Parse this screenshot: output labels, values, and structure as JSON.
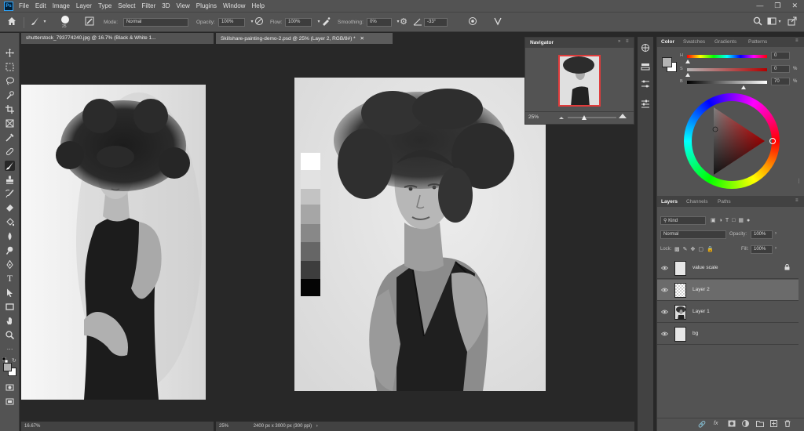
{
  "menu": {
    "logo": "Ps",
    "items": [
      "File",
      "Edit",
      "Image",
      "Layer",
      "Type",
      "Select",
      "Filter",
      "3D",
      "View",
      "Plugins",
      "Window",
      "Help"
    ]
  },
  "options": {
    "brush_size": "25",
    "mode_label": "Mode:",
    "mode_value": "Normal",
    "opacity_label": "Opacity:",
    "opacity_value": "100%",
    "flow_label": "Flow:",
    "flow_value": "100%",
    "smoothing_label": "Smoothing:",
    "smoothing_value": "0%",
    "angle_value": "-33°"
  },
  "documents": {
    "left": {
      "tab": "shutterstock_793774240.jpg @ 16.7% (Black & White 1...",
      "status": "16.67%"
    },
    "main": {
      "tab": "Skillshare-painting-demo-2.psd @ 25% (Layer 2, RGB/8#) *",
      "status_zoom": "25%",
      "status_info": "2400 px x 3000 px (300 ppi)"
    }
  },
  "navigator": {
    "title": "Navigator",
    "zoom": "25%"
  },
  "color_panel": {
    "tabs": [
      "Color",
      "Swatches",
      "Gradients",
      "Patterns"
    ],
    "h_value": "0",
    "s_value": "0",
    "b_value": "70",
    "percent": "%",
    "colors": {
      "foreground": "#b3b3b3",
      "background": "#ffffff",
      "wheel_point": "#ff1a1a"
    }
  },
  "layers_panel": {
    "tabs": [
      "Layers",
      "Channels",
      "Paths"
    ],
    "kind": "Kind",
    "blend_mode": "Normal",
    "opacity_label": "Opacity:",
    "opacity_value": "100%",
    "lock_label": "Lock:",
    "fill_label": "Fill:",
    "fill_value": "100%",
    "layers": [
      {
        "name": "value scale",
        "selected": false,
        "locked": true
      },
      {
        "name": "Layer 2",
        "selected": true,
        "locked": false
      },
      {
        "name": "Layer 1",
        "selected": false,
        "locked": false
      },
      {
        "name": "bg",
        "selected": false,
        "locked": false
      }
    ],
    "footer_icons": [
      "link-icon",
      "fx-icon",
      "mask-icon",
      "adjustment-icon",
      "folder-icon",
      "new-layer-icon",
      "trash-icon"
    ]
  },
  "value_scale": [
    "#ffffff",
    "#e2e2e2",
    "#c3c3c3",
    "#a6a6a6",
    "#888888",
    "#666666",
    "#3d3d3d",
    "#050505"
  ]
}
